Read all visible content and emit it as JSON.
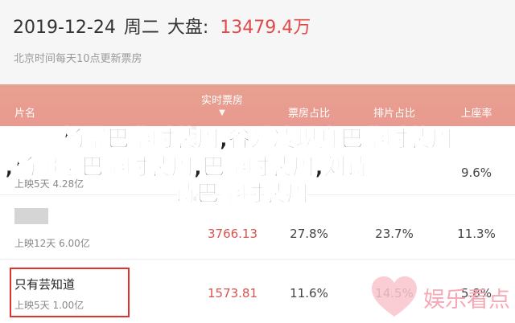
{
  "header": {
    "date": "2019-12-24",
    "weekday": "周二",
    "board_label": "大盘:",
    "total": "13479.4万",
    "subtitle": "北京时间每天10点更新票房"
  },
  "table": {
    "columns": [
      "片名",
      "实时票房",
      "票房占比",
      "排片占比",
      "上座率"
    ],
    "rows": [
      {
        "movie": "",
        "meta": "上映5天 4.28亿",
        "box": "",
        "box_share": "",
        "screen_share": "",
        "attendance": "9.6%"
      },
      {
        "movie": "",
        "meta": "上映12天 6.00亿",
        "box": "3766.13",
        "box_share": "27.8%",
        "screen_share": "23.7%",
        "attendance": "11.3%"
      },
      {
        "movie": "只有芸知道",
        "meta": "上映5天 1.00亿",
        "box": "1573.81",
        "box_share": "11.6%",
        "screen_share": "14.5%",
        "attendance": "5.8%"
      }
    ]
  },
  "overlay": {
    "line1": "杨幂巴黎时装周,谷爱凌现身巴黎时装周",
    "line2": ",杨超越巴黎时装周,巴黎时装周,刘诗",
    "line3": "诗巴黎时装周"
  },
  "watermark": {
    "text": "娱乐看点",
    "heart_color": "#f6a8b4"
  },
  "colors": {
    "accent": "#e24a4a",
    "header_band": "#e99a90"
  }
}
